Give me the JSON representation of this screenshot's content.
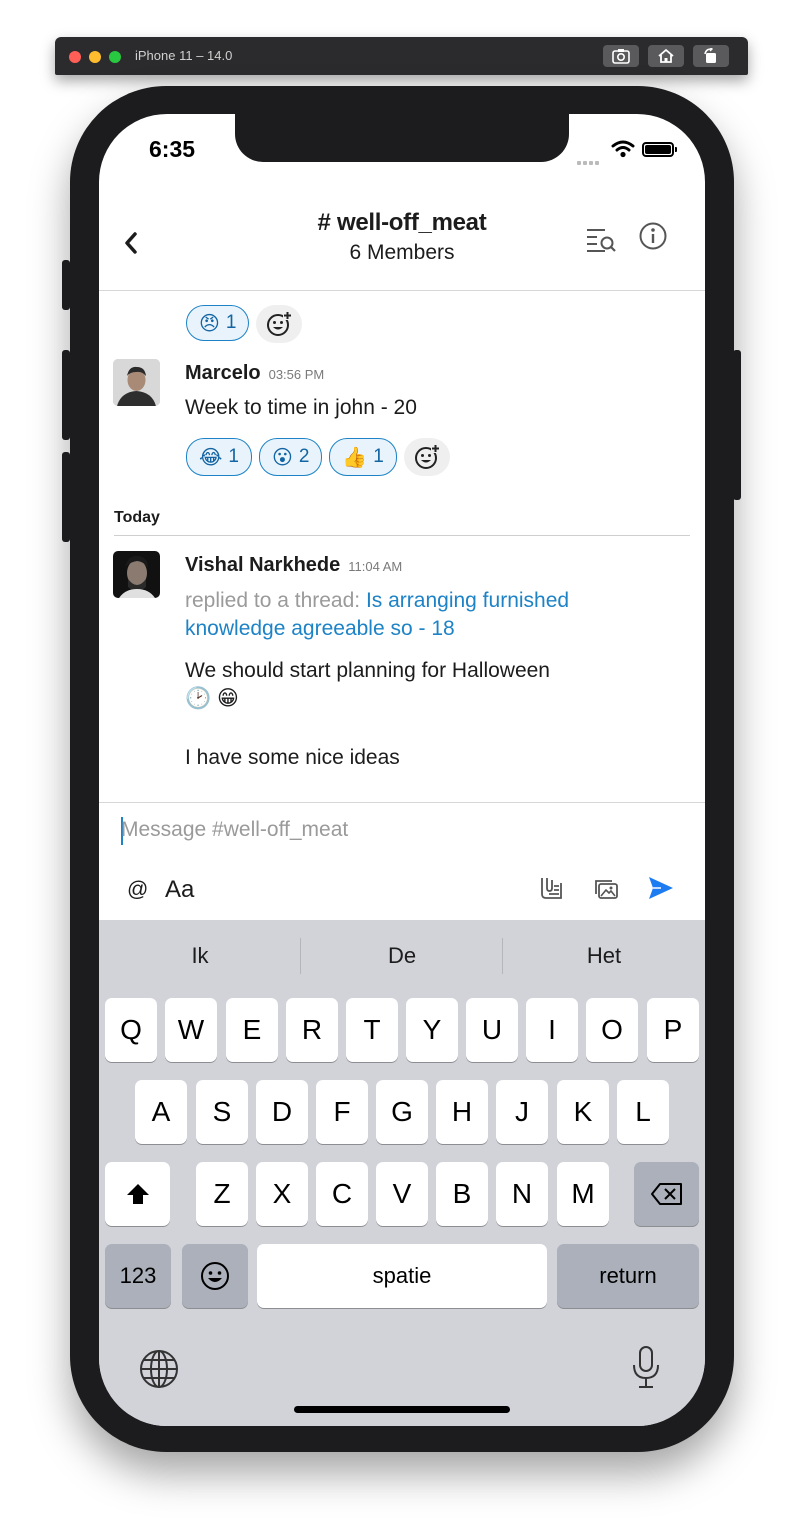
{
  "simulator": {
    "title": "iPhone 11 – 14.0"
  },
  "status_bar": {
    "time": "6:35"
  },
  "header": {
    "channel_title": "# well-off_meat",
    "member_count": "6 Members"
  },
  "messages": [
    {
      "reactions": [
        {
          "emoji": "😠",
          "count": "1"
        }
      ]
    },
    {
      "author": "Marcelo",
      "time": "03:56 PM",
      "text": "Week to time in john - 20",
      "reactions": [
        {
          "emoji": "😂",
          "count": "1"
        },
        {
          "emoji": "😮",
          "count": "2"
        },
        {
          "emoji": "👍",
          "count": "1"
        }
      ]
    },
    {
      "author": "Vishal Narkhede",
      "time": "11:04 AM",
      "thread_prefix": "replied to a thread: ",
      "thread_link": "Is arranging furnished knowledge agreeable so - 18",
      "text_line1": "We should start planning for Halloween",
      "text_line2": "🕑 😁",
      "text_line3": "I have some nice ideas"
    }
  ],
  "day_separator": "Today",
  "composer": {
    "placeholder": "Message #well-off_meat",
    "mention_label": "@",
    "format_label": "Aa"
  },
  "keyboard": {
    "suggestions": [
      "Ik",
      "De",
      "Het"
    ],
    "row1": [
      "Q",
      "W",
      "E",
      "R",
      "T",
      "Y",
      "U",
      "I",
      "O",
      "P"
    ],
    "row2": [
      "A",
      "S",
      "D",
      "F",
      "G",
      "H",
      "J",
      "K",
      "L"
    ],
    "row3": [
      "Z",
      "X",
      "C",
      "V",
      "B",
      "N",
      "M"
    ],
    "numbers_label": "123",
    "space_label": "spatie",
    "return_label": "return"
  },
  "colors": {
    "accent": "#1d83c6",
    "send": "#1d7cf2",
    "keyboard_bg": "#d1d3d9"
  }
}
